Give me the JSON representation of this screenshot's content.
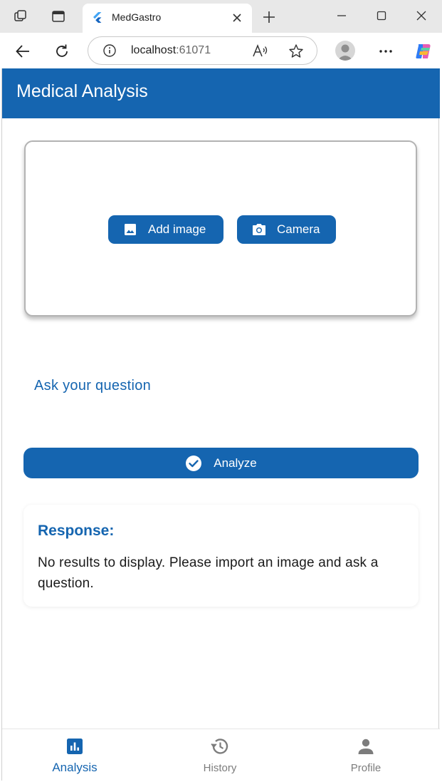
{
  "browser": {
    "tab_title": "MedGastro",
    "address_host": "localhost",
    "address_port": ":61071"
  },
  "app": {
    "title": "Medical Analysis",
    "upload": {
      "add_image_label": "Add image",
      "camera_label": "Camera"
    },
    "question_placeholder": "Ask your question",
    "analyze_label": "Analyze",
    "response": {
      "title": "Response:",
      "text": "No results to display. Please import an image and ask a question."
    },
    "nav": [
      {
        "label": "Analysis",
        "icon": "analytics-icon",
        "active": true
      },
      {
        "label": "History",
        "icon": "history-icon",
        "active": false
      },
      {
        "label": "Profile",
        "icon": "person-icon",
        "active": false
      }
    ]
  },
  "colors": {
    "primary": "#1565b0",
    "inactive": "#7c7c7c"
  }
}
